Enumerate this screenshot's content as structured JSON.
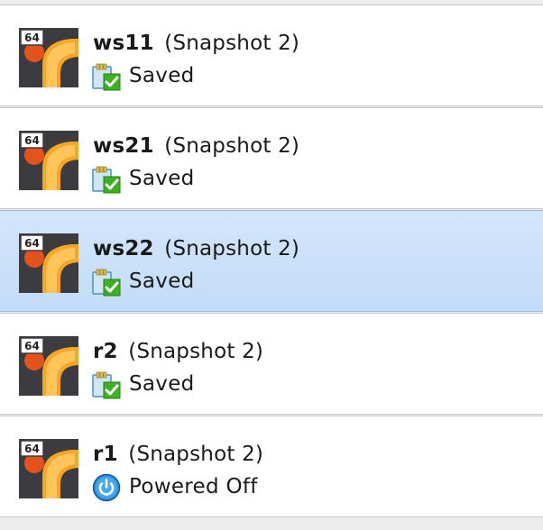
{
  "vms": [
    {
      "name": "ws11",
      "snapshot": "(Snapshot 2)",
      "state": "Saved",
      "state_icon": "saved-state-icon",
      "os_badge": "64",
      "selected": false
    },
    {
      "name": "ws21",
      "snapshot": "(Snapshot 2)",
      "state": "Saved",
      "state_icon": "saved-state-icon",
      "os_badge": "64",
      "selected": false
    },
    {
      "name": "ws22",
      "snapshot": "(Snapshot 2)",
      "state": "Saved",
      "state_icon": "saved-state-icon",
      "os_badge": "64",
      "selected": true
    },
    {
      "name": "r2",
      "snapshot": "(Snapshot 2)",
      "state": "Saved",
      "state_icon": "saved-state-icon",
      "os_badge": "64",
      "selected": false
    },
    {
      "name": "r1",
      "snapshot": "(Snapshot 2)",
      "state": "Powered Off",
      "state_icon": "powered-off-icon",
      "os_badge": "64",
      "selected": false
    }
  ],
  "colors": {
    "selection": "#c8dff8",
    "os_orange": "#f5a623",
    "os_dark": "#3c3c40",
    "saved_green": "#3cb21e",
    "power_blue": "#1e88d8"
  }
}
